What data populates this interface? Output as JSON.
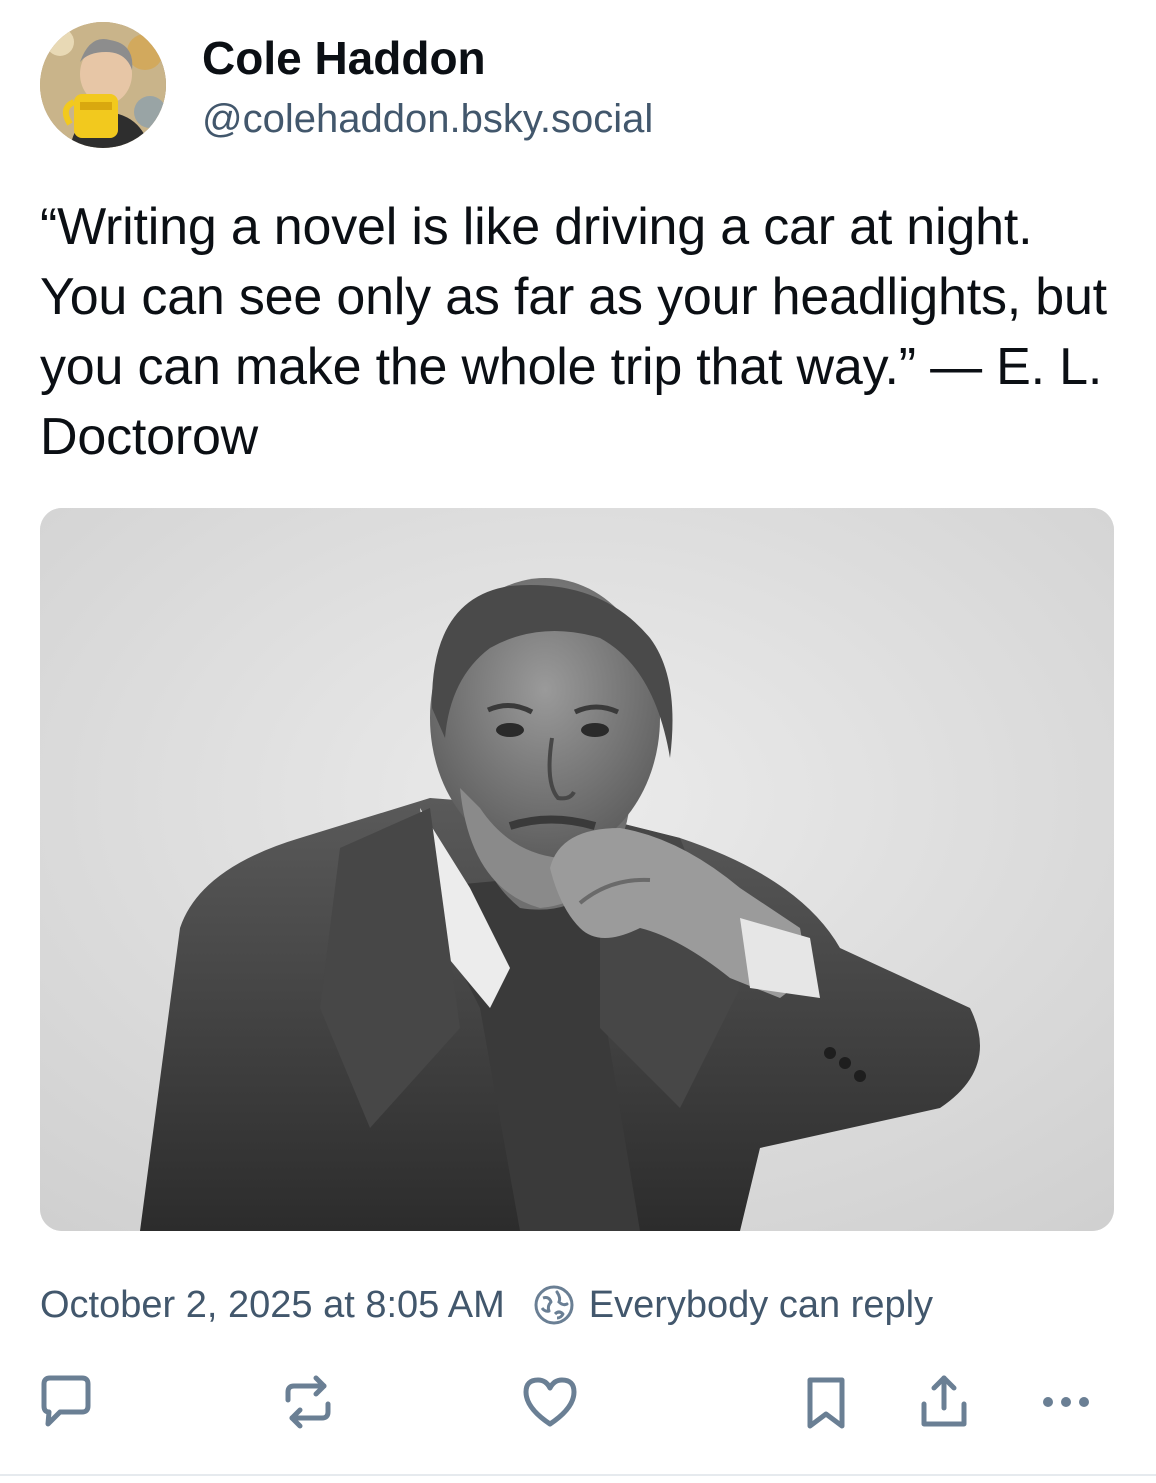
{
  "author": {
    "display_name": "Cole Haddon",
    "handle": "@colehaddon.bsky.social",
    "avatar_icon": "avatar-photo"
  },
  "post": {
    "text": "“Writing a novel is like driving a car at night. You can see only as far as your headlights, but you can make the whole trip that way.” — E. L. Doctorow",
    "image_icon": "portrait-photo"
  },
  "meta": {
    "timestamp": "October 2, 2025 at 8:05 AM",
    "reply_setting": "Everybody can reply",
    "reply_setting_icon": "globe-icon"
  },
  "actions": [
    {
      "name": "reply",
      "icon": "speech-bubble-icon"
    },
    {
      "name": "repost",
      "icon": "repost-icon"
    },
    {
      "name": "like",
      "icon": "heart-icon"
    },
    {
      "name": "bookmark",
      "icon": "bookmark-icon"
    },
    {
      "name": "share",
      "icon": "share-icon"
    },
    {
      "name": "more",
      "icon": "ellipsis-icon"
    }
  ],
  "colors": {
    "text_primary": "#0b0f14",
    "text_secondary": "#42576c",
    "icon": "#6a7f94"
  }
}
